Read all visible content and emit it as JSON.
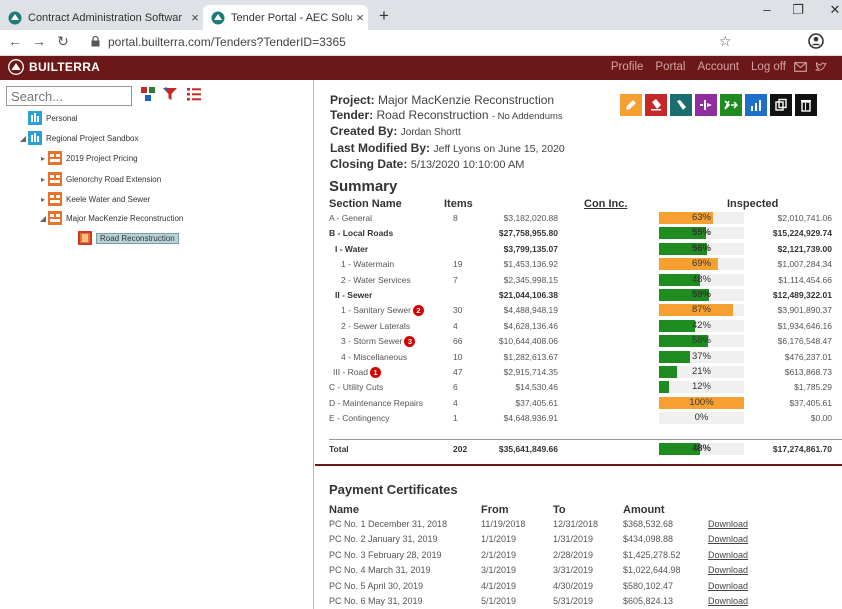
{
  "browser": {
    "tabs": [
      {
        "title": "Contract Administration Softwar"
      },
      {
        "title": "Tender Portal - AEC Solutions"
      }
    ],
    "url": "portal.builterra.com/Tenders?TenderID=3365"
  },
  "app": {
    "logo": "BUILTERRA",
    "nav": [
      "Profile",
      "Portal",
      "Account",
      "Log off"
    ]
  },
  "sidebar": {
    "search_placeholder": "Search...",
    "tree": [
      {
        "label": "Personal"
      },
      {
        "label": "Regional Project Sandbox"
      },
      {
        "label": "2019 Project Pricing"
      },
      {
        "label": "Glenorchy Road Extension"
      },
      {
        "label": "Keele Water and Sewer"
      },
      {
        "label": "Major MacKenzie Reconstruction"
      },
      {
        "label": "Road Reconstruction"
      }
    ]
  },
  "project": {
    "project_label": "Project:",
    "project": "Major MacKenzie Reconstruction",
    "tender_label": "Tender:",
    "tender": "Road Reconstruction",
    "tender_note": "- No Addendums",
    "created_label": "Created By:",
    "created": "Jordan Shortt",
    "modified_label": "Last Modified By:",
    "modified": "Jeff Lyons on June 15, 2020",
    "closing_label": "Closing Date:",
    "closing": "5/13/2020 10:10:00 AM"
  },
  "summary": {
    "title": "Summary",
    "headers": {
      "name": "Section Name",
      "items": "Items",
      "con": "Con Inc.",
      "inspected": "Inspected"
    },
    "rows": [
      {
        "name": "A - General",
        "items": "8",
        "con": "$3,182,020.88",
        "pct": 63,
        "pct_label": "63%",
        "inspected": "$2,010,741.06",
        "bold": false,
        "bar": "#f5a030"
      },
      {
        "name": "B - Local Roads",
        "items": "",
        "con": "$27,758,955.80",
        "pct": 55,
        "pct_label": "55%",
        "inspected": "$15,224,929.74",
        "bold": true,
        "bar": "#1e8c1e"
      },
      {
        "name": "I - Water",
        "items": "",
        "con": "$3,799,135.07",
        "pct": 56,
        "pct_label": "56%",
        "inspected": "$2,121,739.00",
        "bold": true,
        "bar": "#1e8c1e"
      },
      {
        "name": "1 - Watermain",
        "items": "19",
        "con": "$1,453,136.92",
        "pct": 69,
        "pct_label": "69%",
        "inspected": "$1,007,284.34",
        "bold": false,
        "bar": "#f5a030"
      },
      {
        "name": "2 - Water Services",
        "items": "7",
        "con": "$2,345,998.15",
        "pct": 48,
        "pct_label": "48%",
        "inspected": "$1,114,454.66",
        "bold": false,
        "bar": "#1e8c1e"
      },
      {
        "name": "II - Sewer",
        "items": "",
        "con": "$21,044,106.38",
        "pct": 59,
        "pct_label": "59%",
        "inspected": "$12,489,322.01",
        "bold": true,
        "bar": "#1e8c1e"
      },
      {
        "name": "1 - Sanitary Sewer",
        "badge": "2",
        "items": "30",
        "con": "$4,488,948.19",
        "pct": 87,
        "pct_label": "87%",
        "inspected": "$3,901,890.37",
        "bold": false,
        "bar": "#f5a030"
      },
      {
        "name": "2 - Sewer Laterals",
        "items": "4",
        "con": "$4,628,136.46",
        "pct": 42,
        "pct_label": "42%",
        "inspected": "$1,934,646.16",
        "bold": false,
        "bar": "#1e8c1e"
      },
      {
        "name": "3 - Storm Sewer",
        "badge": "3",
        "items": "66",
        "con": "$10,644,408.06",
        "pct": 58,
        "pct_label": "58%",
        "inspected": "$6,176,548.47",
        "bold": false,
        "bar": "#1e8c1e"
      },
      {
        "name": "4 - Miscellaneous",
        "items": "10",
        "con": "$1,282,613.67",
        "pct": 37,
        "pct_label": "37%",
        "inspected": "$476,237.01",
        "bold": false,
        "bar": "#1e8c1e"
      },
      {
        "name": "III - Road",
        "badge": "1",
        "items": "47",
        "con": "$2,915,714.35",
        "pct": 21,
        "pct_label": "21%",
        "inspected": "$613,868.73",
        "bold": false,
        "bar": "#1e8c1e"
      },
      {
        "name": "C - Utility Cuts",
        "items": "6",
        "con": "$14,530.46",
        "pct": 12,
        "pct_label": "12%",
        "inspected": "$1,785.29",
        "bold": false,
        "bar": "#1e8c1e"
      },
      {
        "name": "D - Maintenance Repairs",
        "items": "4",
        "con": "$37,405.61",
        "pct": 100,
        "pct_label": "100%",
        "inspected": "$37,405.61",
        "bold": false,
        "bar": "#f5a030"
      },
      {
        "name": "E - Contingency",
        "items": "1",
        "con": "$4,648,936.91",
        "pct": 0,
        "pct_label": "0%",
        "inspected": "$0.00",
        "bold": false,
        "bar": "#1e8c1e"
      }
    ],
    "total": {
      "name": "Total",
      "items": "202",
      "con": "$35,641,849.66",
      "pct": 48,
      "pct_label": "48%",
      "inspected": "$17,274,861.70"
    }
  },
  "payments": {
    "title": "Payment Certificates",
    "headers": {
      "name": "Name",
      "from": "From",
      "to": "To",
      "amount": "Amount"
    },
    "rows": [
      {
        "name": "PC No. 1 December 31, 2018",
        "from": "11/19/2018",
        "to": "12/31/2018",
        "amount": "$368,532.68",
        "link": "Download"
      },
      {
        "name": "PC No. 2 January 31, 2019",
        "from": "1/1/2019",
        "to": "1/31/2019",
        "amount": "$434,098.88",
        "link": "Download"
      },
      {
        "name": "PC No. 3 February 28, 2019",
        "from": "2/1/2019",
        "to": "2/28/2019",
        "amount": "$1,425,278.52",
        "link": "Download"
      },
      {
        "name": "PC No. 4 March 31, 2019",
        "from": "3/1/2019",
        "to": "3/31/2019",
        "amount": "$1,022,644.98",
        "link": "Download"
      },
      {
        "name": "PC No. 5 April 30, 2019",
        "from": "4/1/2019",
        "to": "4/30/2019",
        "amount": "$580,102.47",
        "link": "Download"
      },
      {
        "name": "PC No. 6 May 31, 2019",
        "from": "5/1/2019",
        "to": "5/31/2019",
        "amount": "$605,824.13",
        "link": "Download"
      }
    ]
  },
  "colors": {
    "brand": "#6d1818",
    "green": "#1e8c1e",
    "orange": "#f5a030"
  }
}
